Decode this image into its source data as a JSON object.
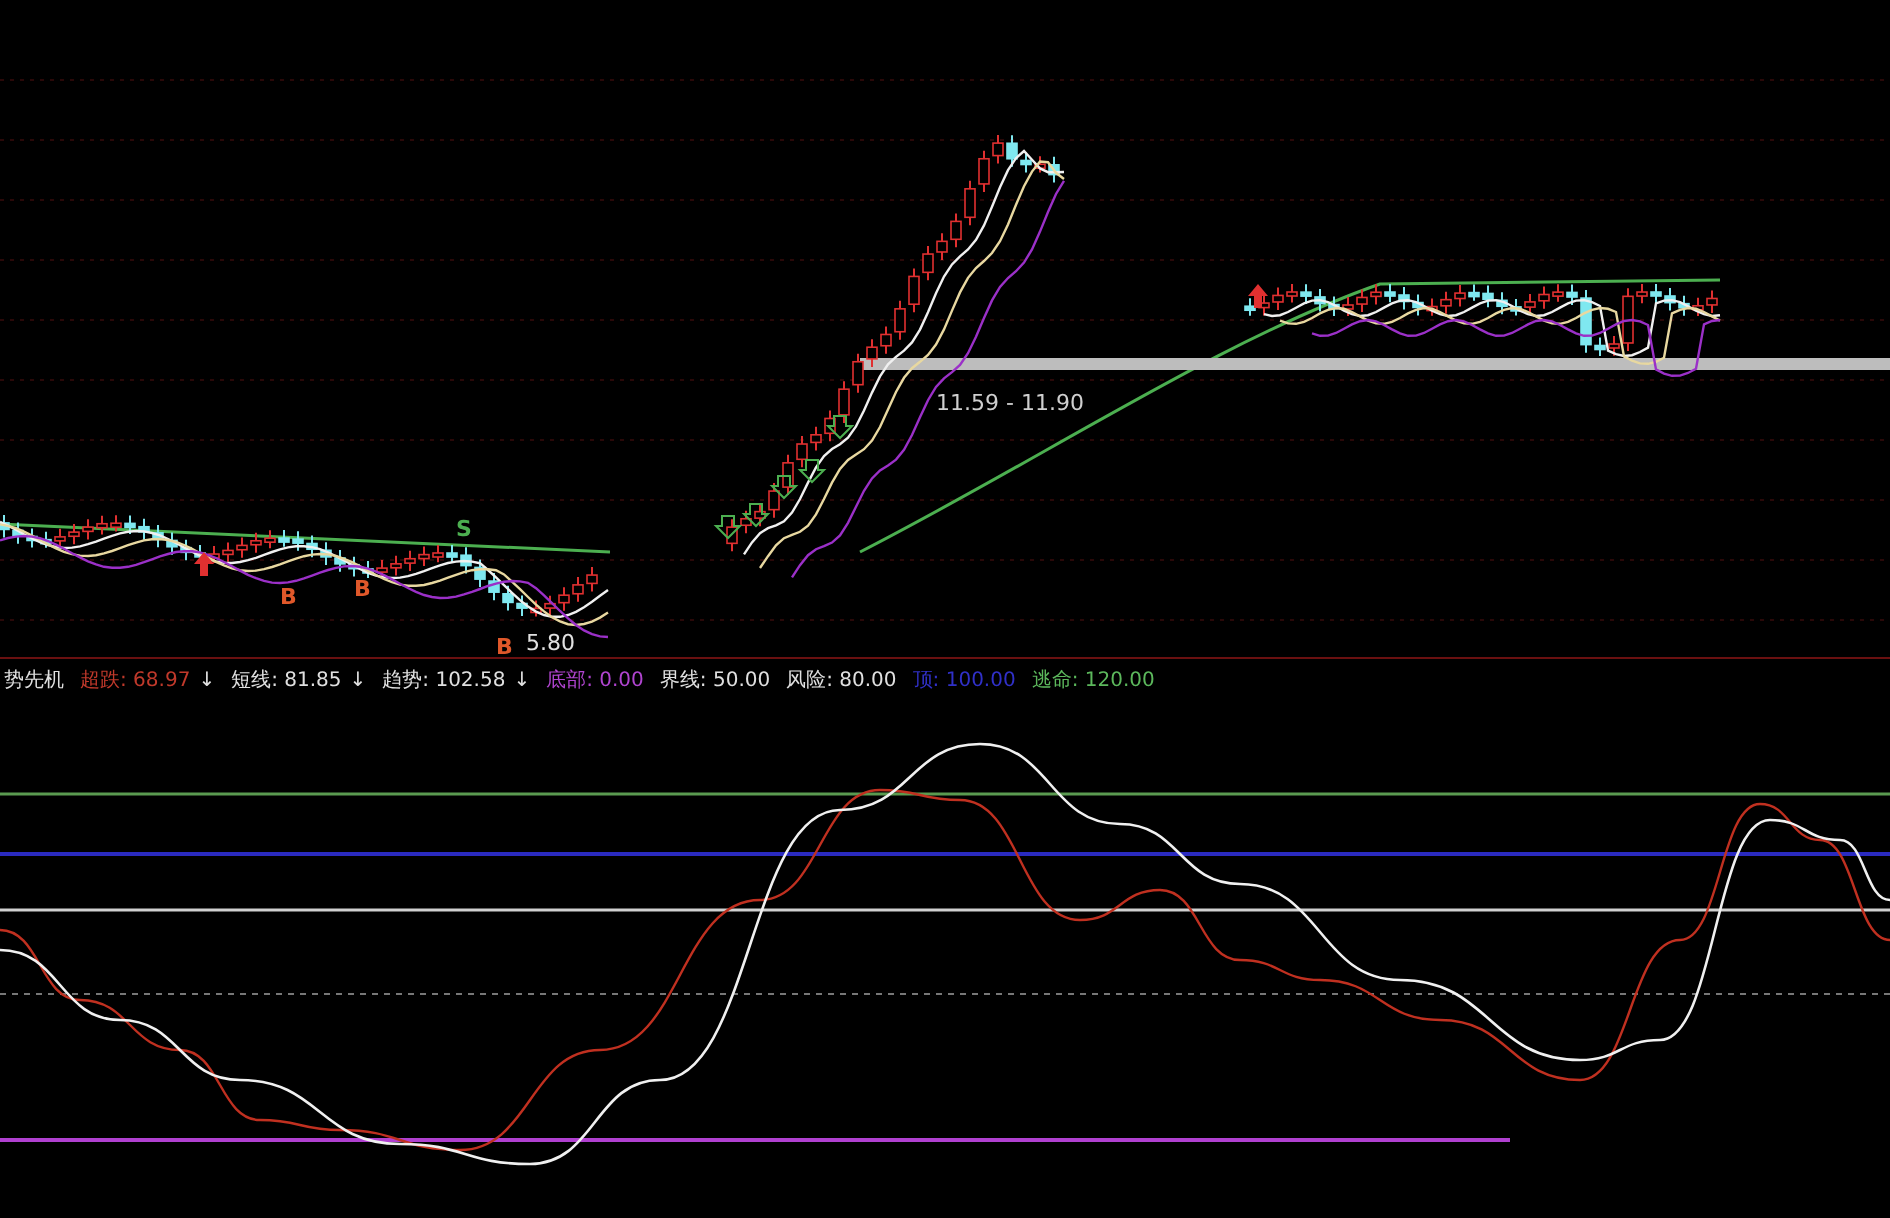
{
  "price_chart": {
    "range_label": "11.59 - 11.90",
    "low_label": "5.80",
    "signals": [
      {
        "kind": "sell",
        "text": "S"
      },
      {
        "kind": "buy",
        "text": "B"
      },
      {
        "kind": "buy",
        "text": "B"
      },
      {
        "kind": "buy",
        "text": "B"
      }
    ]
  },
  "indicator": {
    "name": "势先机",
    "items": [
      {
        "text": "超跌: 68.97",
        "arrow": "↓",
        "color": "#c0392b"
      },
      {
        "text": "短线: 81.85",
        "arrow": "↓",
        "color": "#e0e0e0"
      },
      {
        "text": "趋势: 102.58",
        "arrow": "↓",
        "color": "#e0e0e0"
      },
      {
        "text": "底部: 0.00",
        "color": "#b044d0"
      },
      {
        "text": "界线: 50.00",
        "color": "#e0e0e0"
      },
      {
        "text": "风险: 80.00",
        "color": "#e0e0e0"
      },
      {
        "text": "顶: 100.00",
        "color": "#3030c8"
      },
      {
        "text": "逃命: 120.00",
        "color": "#5cb85c"
      }
    ]
  }
}
